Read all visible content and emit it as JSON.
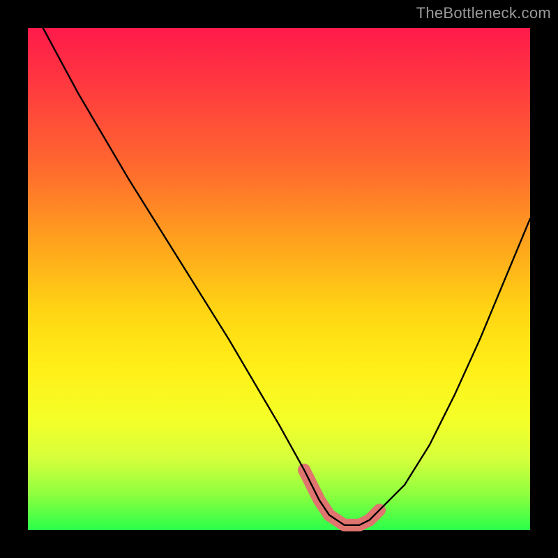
{
  "watermark": "TheBottleneck.com",
  "chart_data": {
    "type": "line",
    "title": "",
    "xlabel": "",
    "ylabel": "",
    "xlim": [
      0,
      100
    ],
    "ylim": [
      0,
      100
    ],
    "series": [
      {
        "name": "bottleneck-curve",
        "x": [
          3,
          10,
          20,
          30,
          40,
          50,
          55,
          58,
          60,
          63,
          66,
          68,
          70,
          75,
          80,
          85,
          90,
          95,
          100
        ],
        "values": [
          100,
          87,
          70,
          54,
          38,
          21,
          12,
          6,
          3,
          1,
          1,
          2,
          4,
          9,
          17,
          27,
          38,
          50,
          62
        ]
      },
      {
        "name": "highlight-band",
        "x": [
          55,
          58,
          60,
          63,
          66,
          68,
          70
        ],
        "values": [
          12,
          6,
          3,
          1,
          1,
          2,
          4
        ]
      }
    ],
    "grid": false,
    "legend_position": "none",
    "colors": {
      "curve": "#000000",
      "highlight": "#e0746f"
    }
  }
}
